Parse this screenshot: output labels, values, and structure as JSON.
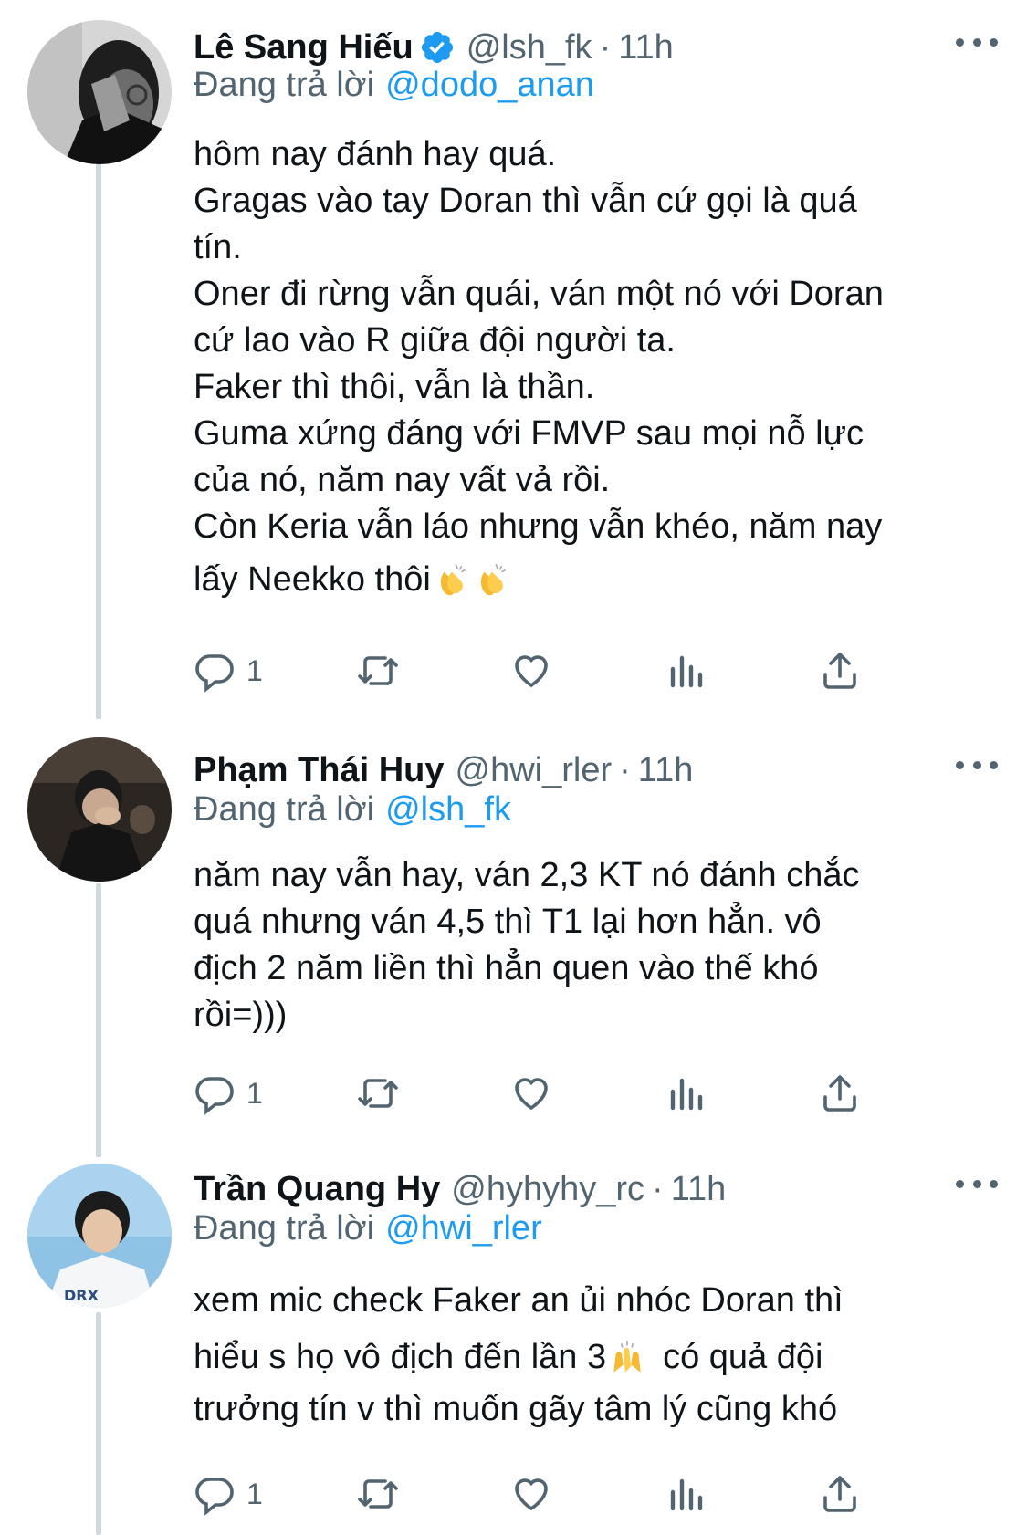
{
  "tweets": [
    {
      "name": "Lê Sang Hiếu",
      "verified": true,
      "handle": "@lsh_fk",
      "separator": "·",
      "time": "11h",
      "replying_label": "Đang trả lời",
      "replying_to": "@dodo_anan",
      "lines": [
        "hôm nay đánh hay quá.",
        "Gragas vào tay Doran thì vẫn cứ gọi là quá",
        "tín.",
        "Oner đi rừng vẫn quái, ván một nó với Doran",
        "cứ lao vào R giữa đội người ta.",
        "Faker thì thôi, vẫn là thần.",
        "Guma xứng đáng với FMVP sau mọi nỗ lực",
        "của nó, năm nay vất vả rồi.",
        "Còn Keria vẫn láo nhưng vẫn khéo, năm nay",
        "lấy Neekko thôi"
      ],
      "reply_count": "1"
    },
    {
      "name": "Phạm Thái Huy",
      "verified": false,
      "handle": "@hwi_rler",
      "separator": "·",
      "time": "11h",
      "replying_label": "Đang trả lời",
      "replying_to": "@lsh_fk",
      "lines": [
        "năm nay vẫn hay, ván 2,3 KT nó đánh chắc",
        "quá nhưng ván 4,5 thì T1 lại hơn hẳn. vô",
        "địch 2 năm liền thì hẳn quen vào thế khó",
        "rồi=)))"
      ],
      "reply_count": "1"
    },
    {
      "name": "Trần Quang Hy",
      "verified": false,
      "handle": "@hyhyhy_rc",
      "separator": "·",
      "time": "11h",
      "replying_label": "Đang trả lời",
      "replying_to": "@hwi_rler",
      "lines": [
        "xem mic check Faker an ủi nhóc Doran thì",
        "hiểu s họ vô địch đến lần 3",
        "có quả đội",
        "trưởng tín v thì muốn gãy tâm lý cũng khó"
      ],
      "reply_count": "1"
    }
  ],
  "icons": {
    "reply": "reply-icon",
    "retweet": "retweet-icon",
    "like": "heart-icon",
    "views": "analytics-icon",
    "share": "share-icon",
    "more": "more-icon",
    "verified": "verified-badge-icon",
    "clap": "clapping-hands-emoji",
    "raised_hands": "raising-hands-emoji"
  },
  "colors": {
    "link": "#1d9bf0",
    "secondary": "#536471",
    "thread_line": "#cfd9de",
    "verified": "#1d9bf0"
  }
}
